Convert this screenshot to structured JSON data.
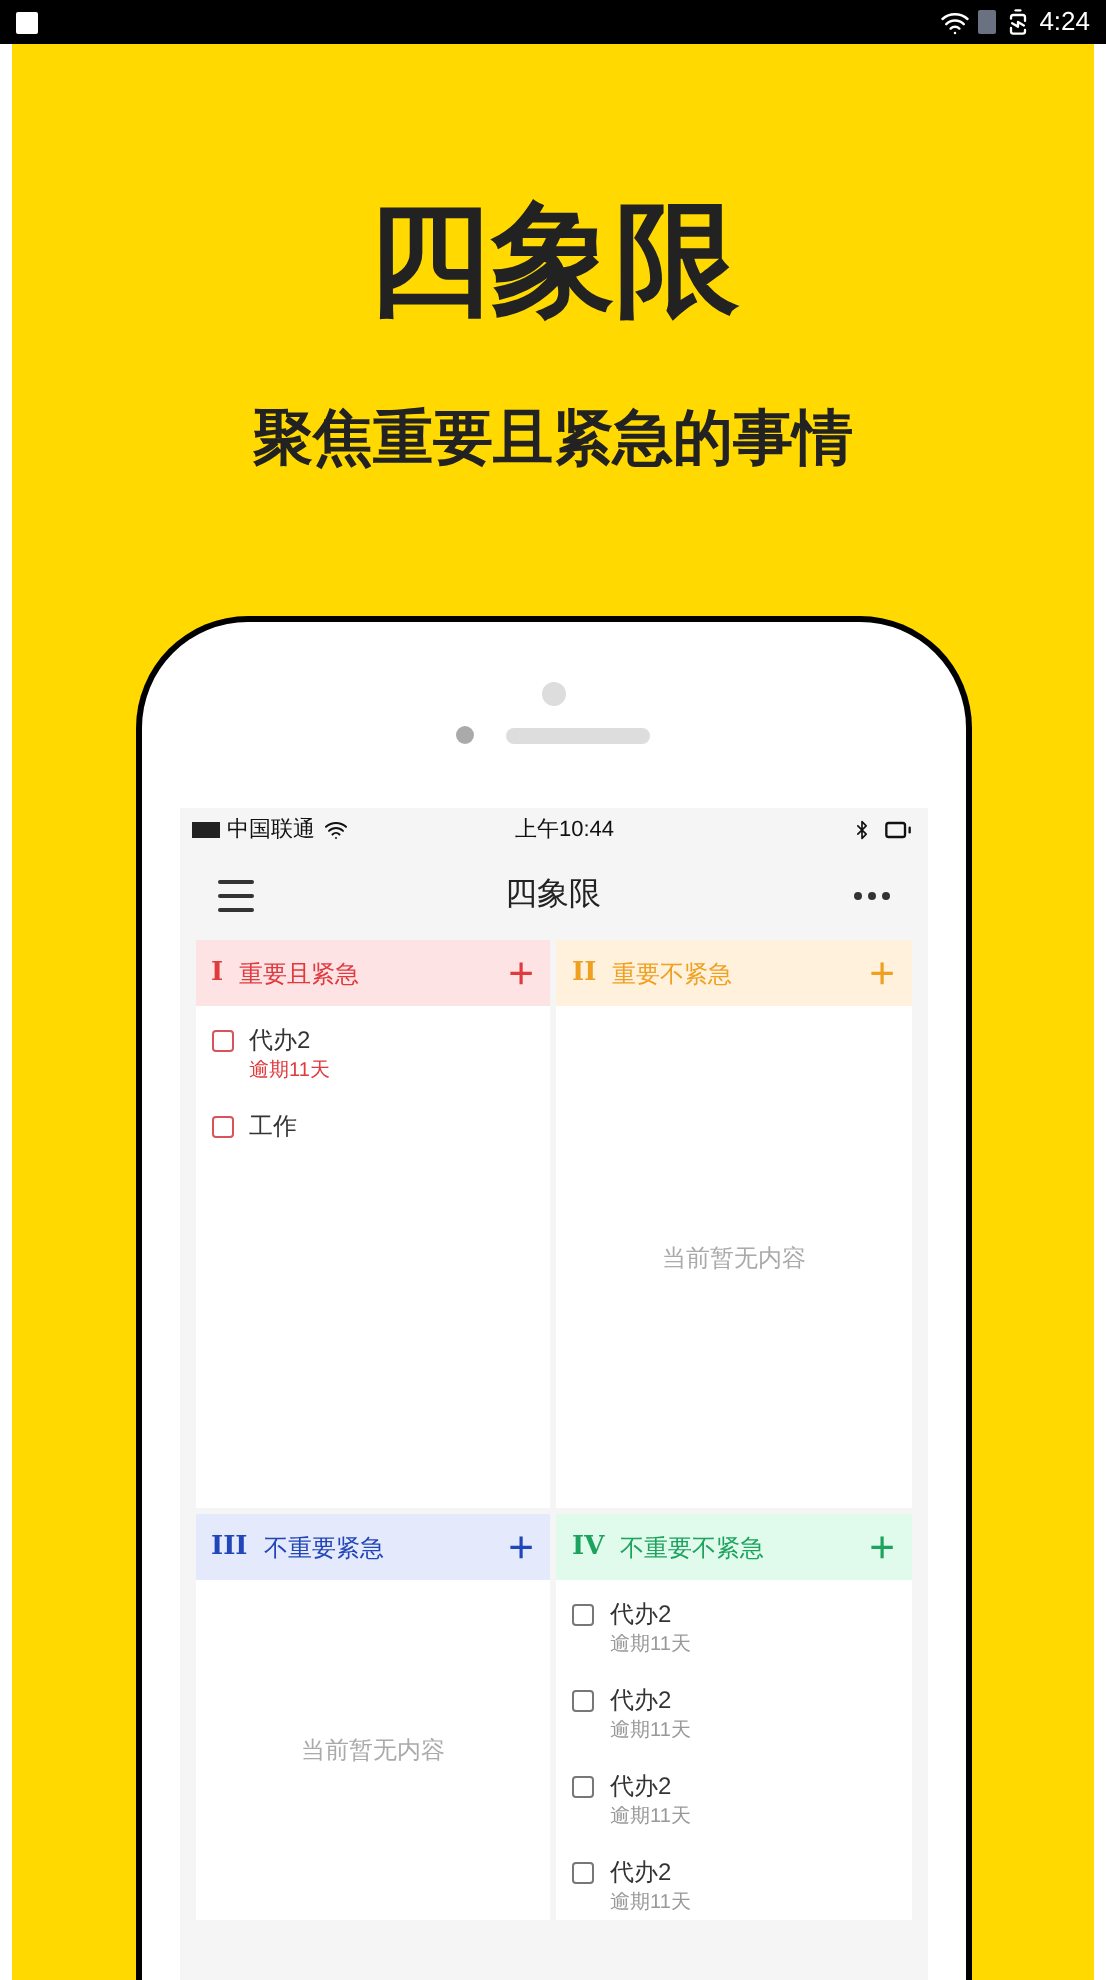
{
  "status_bar": {
    "time": "4:24"
  },
  "headline": "四象限",
  "tagline": "聚焦重要且紧急的事情",
  "phone": {
    "status_bar": {
      "carrier": "中国联通",
      "time": "上午10:44"
    },
    "nav": {
      "title": "四象限"
    },
    "quadrants": [
      {
        "kind": "important-urgent",
        "numeral": "I",
        "label": "重要且紧急",
        "plus": "+",
        "items": [
          {
            "title": "代办2",
            "note": "逾期11天",
            "checked": false
          },
          {
            "title": "工作",
            "checked": false
          }
        ]
      },
      {
        "kind": "important",
        "numeral": "II",
        "label": "重要不紧急",
        "plus": "+",
        "empty": "当前暂无内容"
      },
      {
        "kind": "urgent",
        "numeral": "III",
        "label": "不重要紧急",
        "plus": "+",
        "empty": "当前暂无内容"
      },
      {
        "kind": "neither",
        "numeral": "IV",
        "label": "不重要不紧急",
        "plus": "+",
        "items": [
          {
            "title": "代办2",
            "note": "逾期11天",
            "checked": false
          },
          {
            "title": "代办2",
            "note": "逾期11天",
            "checked": false
          },
          {
            "title": "代办2",
            "note": "逾期11天",
            "checked": false
          },
          {
            "title": "代办2",
            "note": "逾期11天",
            "checked": false
          }
        ]
      }
    ]
  }
}
